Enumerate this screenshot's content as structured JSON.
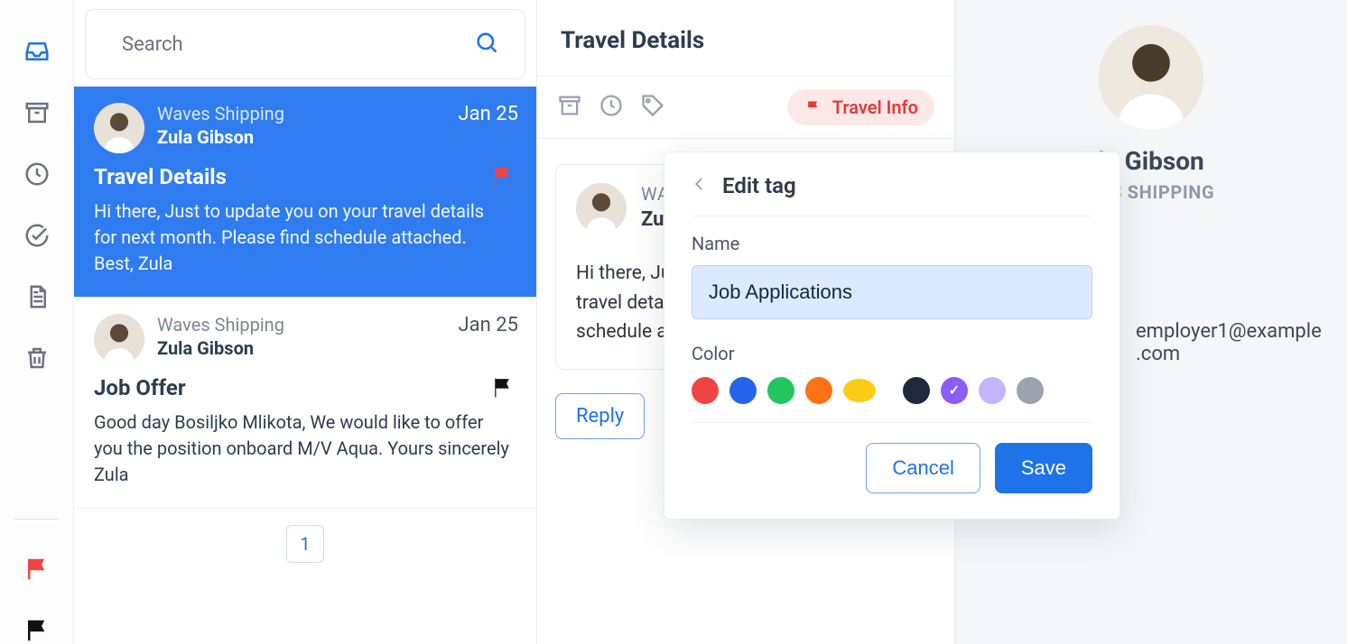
{
  "search": {
    "placeholder": "Search"
  },
  "rail": {},
  "messages": [
    {
      "org": "Waves Shipping",
      "person": "Zula Gibson",
      "date": "Jan 25",
      "subject": "Travel Details",
      "preview": "Hi there, Just to update you on your travel details for next month. Please find schedule attached. Best, Zula",
      "flag_color": "#ef4444",
      "selected": true
    },
    {
      "org": "Waves Shipping",
      "person": "Zula Gibson",
      "date": "Jan 25",
      "subject": "Job Offer",
      "preview": "Good day Bosiljko Mlikota, We would like to offer you the position onboard M/V Aqua. Yours sincerely Zula",
      "flag_color": "#111111",
      "selected": false
    }
  ],
  "pager": {
    "page": "1"
  },
  "reader": {
    "title": "Travel Details",
    "tag_label": "Travel Info",
    "from_org": "WAVES SHIPPING",
    "from_person": "Zula Gibson",
    "body": "Hi there, Just to update you on your travel details for next month. Please find schedule attached.",
    "reply_label": "Reply"
  },
  "contact": {
    "name": "Zula Gibson",
    "name_visible": "la Gibson",
    "org": "WAVES SHIPPING",
    "org_visible": "VES SHIPPING",
    "email": "employer1@example.com"
  },
  "popover": {
    "title": "Edit tag",
    "name_label": "Name",
    "name_value": "Job Applications",
    "color_label": "Color",
    "colors": [
      {
        "hex": "#ef4444",
        "selected": false
      },
      {
        "hex": "#2563eb",
        "selected": false
      },
      {
        "hex": "#22c55e",
        "selected": false
      },
      {
        "hex": "#f97316",
        "selected": false
      },
      {
        "hex": "#facc15",
        "selected": false,
        "ellipse": true
      },
      {
        "hex": "#1e293b",
        "selected": false
      },
      {
        "hex": "#8b5cf6",
        "selected": true
      },
      {
        "hex": "#c4b5fd",
        "selected": false
      },
      {
        "hex": "#9ca3af",
        "selected": false
      }
    ],
    "cancel": "Cancel",
    "save": "Save"
  }
}
